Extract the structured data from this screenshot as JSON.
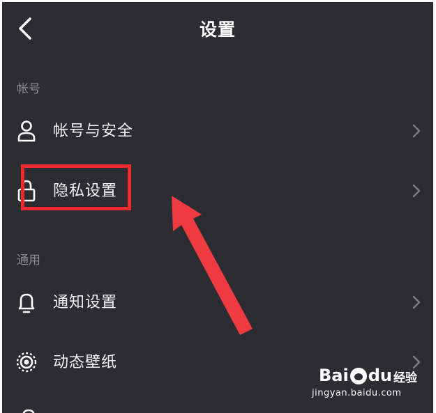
{
  "header": {
    "title": "设置"
  },
  "sections": [
    {
      "label": "帐号",
      "items": [
        {
          "label": "帐号与安全",
          "icon": "user-icon"
        },
        {
          "label": "隐私设置",
          "icon": "lock-icon"
        }
      ]
    },
    {
      "label": "通用",
      "items": [
        {
          "label": "通知设置",
          "icon": "bell-icon"
        },
        {
          "label": "动态壁纸",
          "icon": "live-wallpaper-icon"
        }
      ]
    }
  ],
  "annotation": {
    "highlight_color": "#ee2a2f",
    "arrow_color": "#ee3a40"
  },
  "watermark": {
    "logo": "Bai",
    "logo_tail": "经验",
    "url": "jingyan.baidu.com"
  },
  "colors": {
    "background": "#2c2d33",
    "text": "#f2f2f2",
    "section_label": "#8a8b92"
  }
}
